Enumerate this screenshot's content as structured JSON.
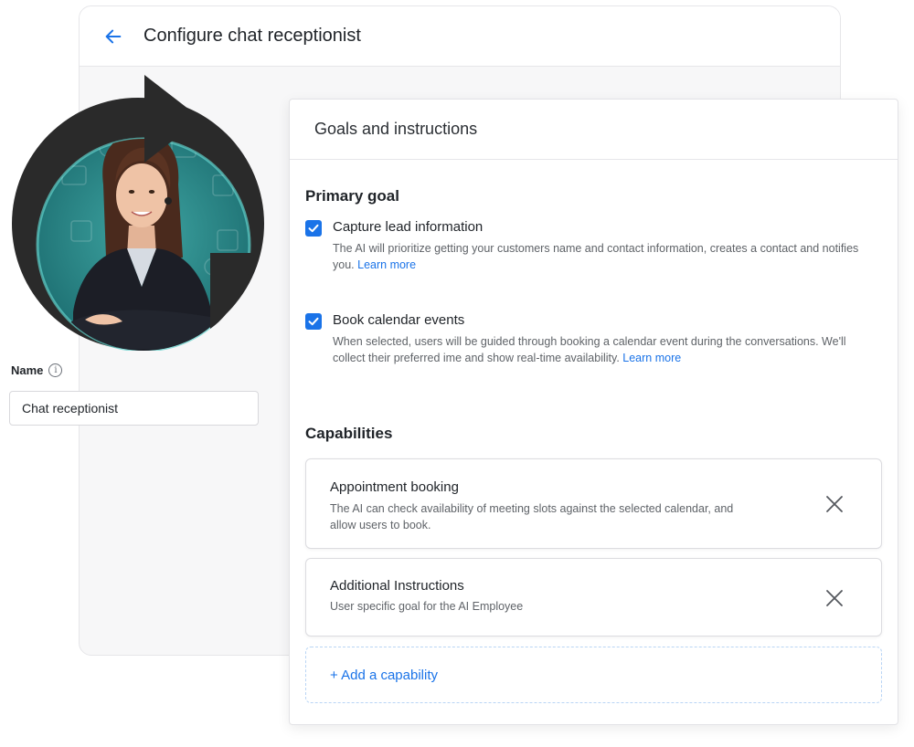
{
  "header": {
    "title": "Configure chat receptionist"
  },
  "profile": {
    "name_label": "Name",
    "name_value": "Chat receptionist"
  },
  "panel": {
    "title": "Goals and instructions",
    "primary_goal": {
      "heading": "Primary goal",
      "items": [
        {
          "title": "Capture lead information",
          "checked": true,
          "description": "The AI will prioritize getting your customers name and contact information, creates a contact and notifies you.",
          "link": "Learn more"
        },
        {
          "title": "Book calendar events",
          "checked": true,
          "description": "When selected, users will be guided through booking a calendar event during the conversations. We'll collect their preferred ime and show real-time availability.",
          "link": "Learn more"
        }
      ]
    },
    "capabilities": {
      "heading": "Capabilities",
      "items": [
        {
          "title": "Appointment booking",
          "description": "The AI can check availability of meeting slots against the selected calendar, and allow users to book."
        },
        {
          "title": "Additional Instructions",
          "description": "User specific goal for the AI Employee"
        }
      ],
      "add_label": "+ Add a capability"
    }
  },
  "colors": {
    "accent": "#1a73e8",
    "teal": "#2a8d8d",
    "dark_arrow": "#2a2a2a"
  }
}
